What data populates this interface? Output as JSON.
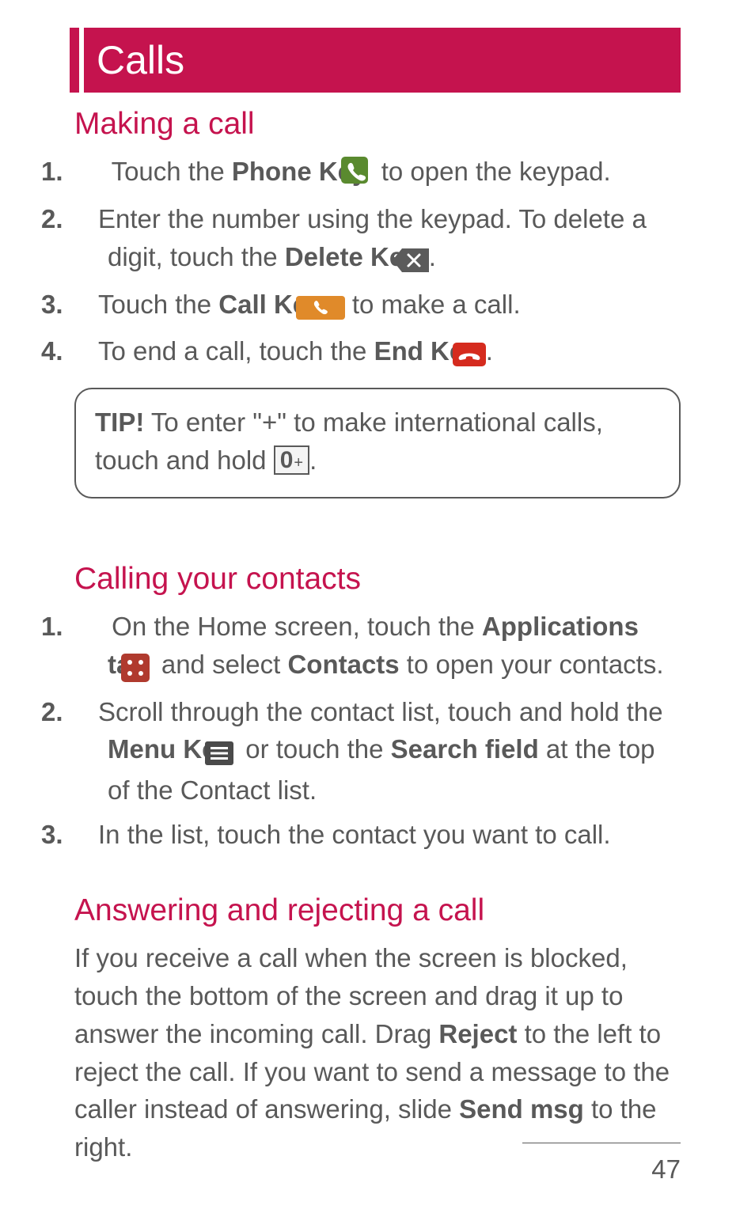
{
  "chapter": {
    "title": "Calls"
  },
  "sections": {
    "making_call": {
      "title": "Making a call",
      "steps": [
        {
          "num": "1.",
          "pre": " Touch the ",
          "bold1": "Phone Key",
          "post": " to open the keypad."
        },
        {
          "num": "2.",
          "pre": "Enter the number using the keypad. To delete a digit, touch the ",
          "bold1": "Delete Key",
          "post": "."
        },
        {
          "num": "3.",
          "pre": "Touch the ",
          "bold1": "Call Key",
          "post": " to make a call."
        },
        {
          "num": "4.",
          "pre": "To end a call, touch the ",
          "bold1": "End Key",
          "post": "."
        }
      ],
      "tip": {
        "label": "TIP!",
        "text_before": " To enter \"+\" to make international calls, touch and hold ",
        "key_label_main": "0",
        "key_label_sub": "+",
        "text_after": "."
      }
    },
    "calling_contacts": {
      "title": "Calling your contacts",
      "steps": [
        {
          "num": "1.",
          "pre": " On the Home screen, touch the ",
          "bold1": "Applications tab",
          "mid1": " and select ",
          "bold2": "Contacts",
          "post": " to open your contacts."
        },
        {
          "num": "2.",
          "pre": "Scroll through the contact list, touch and hold the ",
          "bold1": "Menu Key",
          "mid1": " or touch the ",
          "bold2": "Search field",
          "post": " at the top of the Contact list."
        },
        {
          "num": "3.",
          "pre": "In the list, touch the contact you want to call."
        }
      ]
    },
    "answering": {
      "title": "Answering and rejecting a call",
      "para_parts": {
        "p1": "If you receive a call when the screen is blocked, touch the bottom of the screen and drag it up to answer the incoming call. Drag ",
        "b1": "Reject",
        "p2": " to the left to reject the call. If you want to send a message to the caller instead of answering, slide ",
        "b2": "Send msg",
        "p3": " to the right."
      }
    }
  },
  "page_number": "47"
}
